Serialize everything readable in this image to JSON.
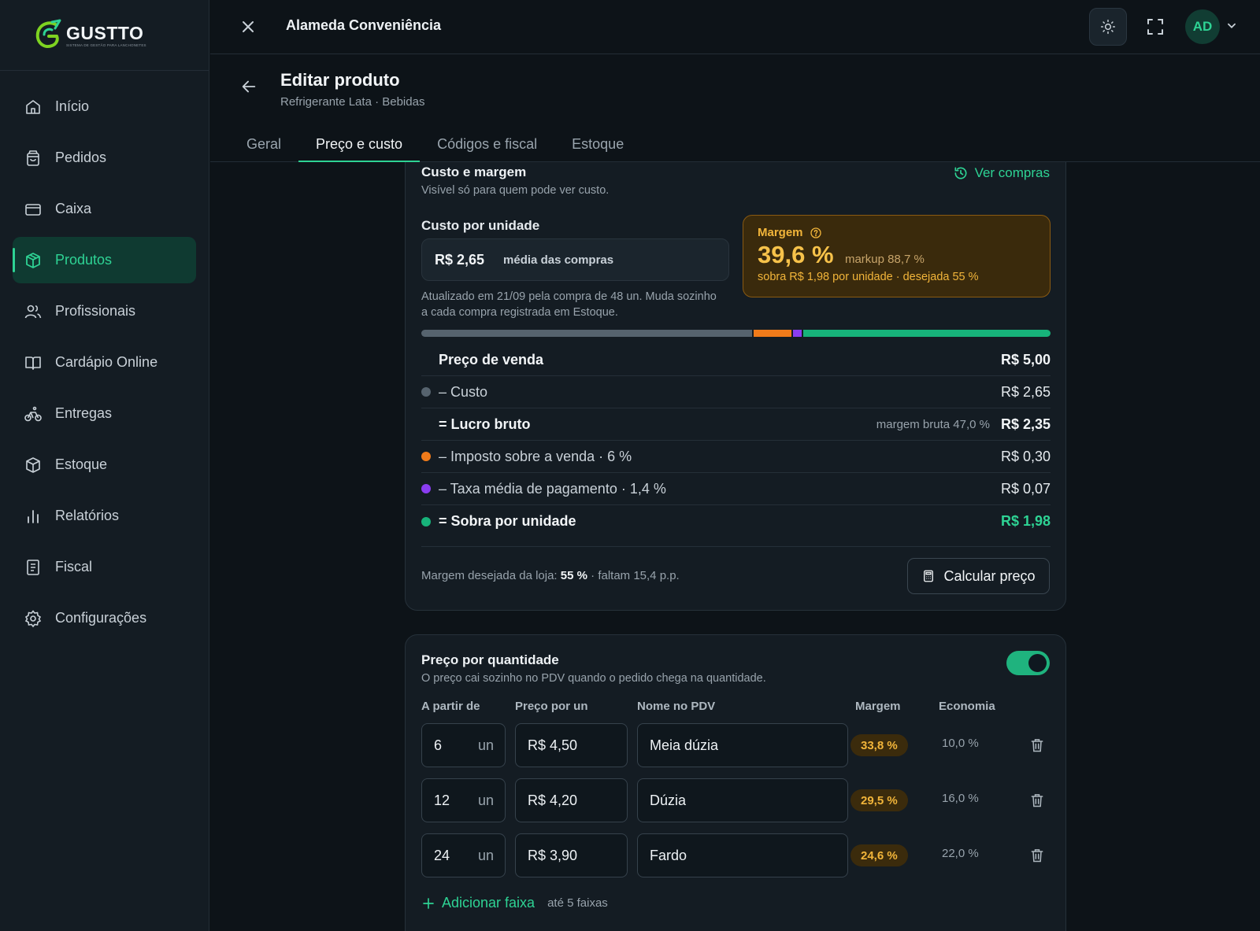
{
  "brand": {
    "name": "GUSTTO",
    "tagline": "SISTEMA DE GESTÃO PARA LANCHONETES"
  },
  "sidebar": {
    "items": [
      {
        "label": "Início",
        "icon": "home-icon",
        "active": false
      },
      {
        "label": "Pedidos",
        "icon": "bag-icon",
        "active": false
      },
      {
        "label": "Caixa",
        "icon": "card-icon",
        "active": false
      },
      {
        "label": "Produtos",
        "icon": "box-icon",
        "active": true
      },
      {
        "label": "Profissionais",
        "icon": "users-icon",
        "active": false
      },
      {
        "label": "Cardápio Online",
        "icon": "book-icon",
        "active": false
      },
      {
        "label": "Entregas",
        "icon": "bike-icon",
        "active": false
      },
      {
        "label": "Estoque",
        "icon": "package-icon",
        "active": false
      },
      {
        "label": "Relatórios",
        "icon": "chart-icon",
        "active": false
      },
      {
        "label": "Fiscal",
        "icon": "receipt-icon",
        "active": false
      },
      {
        "label": "Configurações",
        "icon": "gear-icon",
        "active": false
      }
    ]
  },
  "topbar": {
    "store": "Alameda Conveniência",
    "avatar": "AD"
  },
  "header": {
    "title": "Editar produto",
    "subtitle": "Refrigerante Lata · Bebidas"
  },
  "tabs": [
    {
      "label": "Geral"
    },
    {
      "label": "Preço e custo"
    },
    {
      "label": "Códigos e fiscal"
    },
    {
      "label": "Estoque"
    }
  ],
  "cost": {
    "title": "Custo e margem",
    "subtitle": "Visível só para quem pode ver custo.",
    "ver_compras": "Ver compras",
    "unit_label": "Custo por unidade",
    "unit_value": "R$ 2,65",
    "unit_mode": "média das compras",
    "updated": "Atualizado em 21/09 pela compra de 48 un. Muda sozinho a cada compra registrada em Estoque.",
    "margin": {
      "label": "Margem",
      "value": "39,6 %",
      "markup": "markup 88,7 %",
      "detail": "sobra R$ 1,98 por unidade · desejada 55 %"
    },
    "bar": [
      {
        "name": "custo",
        "fraction": 0.53,
        "color": "#56636e"
      },
      {
        "name": "imposto",
        "fraction": 0.06,
        "color": "#f07b1a"
      },
      {
        "name": "taxa",
        "fraction": 0.014,
        "color": "#8a3df0"
      },
      {
        "name": "sobra",
        "fraction": 0.396,
        "color": "#17b37a"
      }
    ],
    "rows": [
      {
        "label": "Preço de venda",
        "value": "R$ 5,00",
        "bold": true,
        "dot": ""
      },
      {
        "label": "– Custo",
        "value": "R$ 2,65",
        "bold": false,
        "dot": "#56636e"
      },
      {
        "label": "= Lucro bruto",
        "value": "R$ 2,35",
        "bold": true,
        "dot": "",
        "note": "margem bruta 47,0 %"
      },
      {
        "label": "– Imposto sobre a venda · 6 %",
        "value": "R$ 0,30",
        "bold": false,
        "dot": "#f07b1a"
      },
      {
        "label": "– Taxa média de pagamento · 1,4 %",
        "value": "R$ 0,07",
        "bold": false,
        "dot": "#8a3df0"
      },
      {
        "label": "= Sobra por unidade",
        "value": "R$ 1,98",
        "bold": true,
        "dot": "#17b37a",
        "green": true
      }
    ],
    "footer_prefix": "Margem desejada da loja: ",
    "footer_target": "55 %",
    "footer_suffix": " · faltam 15,4 p.p.",
    "calc_button": "Calcular preço"
  },
  "qty": {
    "title": "Preço por quantidade",
    "subtitle": "O preço cai sozinho no PDV quando o pedido chega na quantidade.",
    "enabled": true,
    "headers": {
      "from": "A partir de",
      "price": "Preço por un",
      "name": "Nome no PDV",
      "margin": "Margem",
      "saving": "Economia"
    },
    "tiers": [
      {
        "qty": "6",
        "unit": "un",
        "price": "R$ 4,50",
        "name": "Meia dúzia",
        "margin": "33,8 %",
        "saving": "10,0 %"
      },
      {
        "qty": "12",
        "unit": "un",
        "price": "R$ 4,20",
        "name": "Dúzia",
        "margin": "29,5 %",
        "saving": "16,0 %"
      },
      {
        "qty": "24",
        "unit": "un",
        "price": "R$ 3,90",
        "name": "Fardo",
        "margin": "24,6 %",
        "saving": "22,0 %"
      }
    ],
    "add_label": "Adicionar faixa",
    "add_note": "até 5 faixas"
  }
}
